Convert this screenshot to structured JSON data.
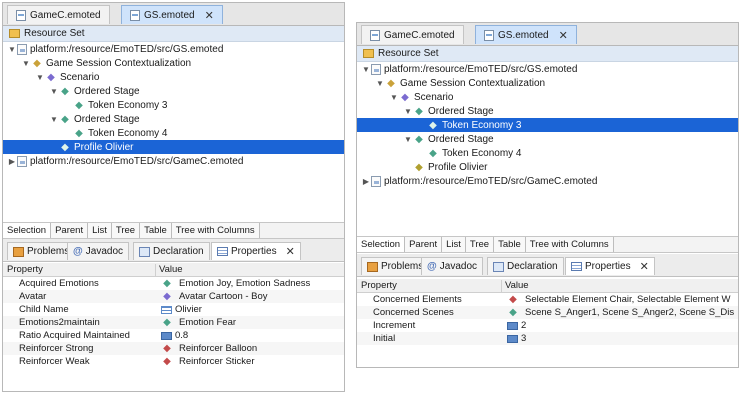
{
  "left": {
    "editor_tabs": [
      {
        "label": "GameC.emoted",
        "active": false
      },
      {
        "label": "GS.emoted",
        "active": true,
        "close": "✕"
      }
    ],
    "resource_set": "Resource Set",
    "tree": [
      {
        "label": "platform:/resource/EmoTED/src/GS.emoted",
        "icon": "page-icon",
        "twisty": "▼",
        "depth": 0
      },
      {
        "label": "Game Session Contextualization",
        "icon": "gold-diamond-icon",
        "twisty": "▼",
        "depth": 1
      },
      {
        "label": "Scenario",
        "icon": "purple-diamond-icon",
        "twisty": "▼",
        "depth": 2
      },
      {
        "label": "Ordered Stage",
        "icon": "teal-diamond-icon",
        "twisty": "▼",
        "depth": 3
      },
      {
        "label": "Token Economy 3",
        "icon": "teal-diamond-icon",
        "twisty": "",
        "depth": 4
      },
      {
        "label": "Ordered Stage",
        "icon": "teal-diamond-icon",
        "twisty": "▼",
        "depth": 3
      },
      {
        "label": "Token Economy 4",
        "icon": "teal-diamond-icon",
        "twisty": "",
        "depth": 4
      },
      {
        "label": "Profile Olivier",
        "icon": "olive-diamond-icon",
        "twisty": "",
        "depth": 3,
        "selected": true
      },
      {
        "label": "platform:/resource/EmoTED/src/GameC.emoted",
        "icon": "page-icon",
        "twisty": "▶",
        "depth": 0
      }
    ],
    "viewer_tabs": [
      "Selection",
      "Parent",
      "List",
      "Tree",
      "Table",
      "Tree with Columns"
    ],
    "view_tabs": [
      {
        "label": "Problems",
        "icon": "problems-icon"
      },
      {
        "label": "Javadoc",
        "icon": "at-icon"
      },
      {
        "label": "Declaration",
        "icon": "declaration-icon"
      },
      {
        "label": "Properties",
        "icon": "properties-icon",
        "active": true,
        "close": "✕"
      }
    ],
    "props_header": {
      "property": "Property",
      "value": "Value"
    },
    "props": [
      {
        "key": "Acquired Emotions",
        "value": "Emotion Joy, Emotion Sadness",
        "icon": "teal-diamond-icon"
      },
      {
        "key": "Avatar",
        "value": "Avatar Cartoon - Boy",
        "icon": "purple-diamond-icon"
      },
      {
        "key": "Child Name",
        "value": "Olivier",
        "icon": "list-icon"
      },
      {
        "key": "Emotions2maintain",
        "value": "Emotion Fear",
        "icon": "teal-diamond-icon"
      },
      {
        "key": "Ratio Acquired Maintained",
        "value": "0.8",
        "icon": "number-icon"
      },
      {
        "key": "Reinforcer Strong",
        "value": "Reinforcer Balloon",
        "icon": "red-diamond-icon"
      },
      {
        "key": "Reinforcer Weak",
        "value": "Reinforcer Sticker",
        "icon": "red-diamond-icon"
      }
    ]
  },
  "right": {
    "editor_tabs": [
      {
        "label": "GameC.emoted",
        "active": false
      },
      {
        "label": "GS.emoted",
        "active": true,
        "close": "✕"
      }
    ],
    "resource_set": "Resource Set",
    "tree": [
      {
        "label": "platform:/resource/EmoTED/src/GS.emoted",
        "icon": "page-icon",
        "twisty": "▼",
        "depth": 0
      },
      {
        "label": "Game Session Contextualization",
        "icon": "gold-diamond-icon",
        "twisty": "▼",
        "depth": 1
      },
      {
        "label": "Scenario",
        "icon": "purple-diamond-icon",
        "twisty": "▼",
        "depth": 2
      },
      {
        "label": "Ordered Stage",
        "icon": "teal-diamond-icon",
        "twisty": "▼",
        "depth": 3
      },
      {
        "label": "Token Economy 3",
        "icon": "teal-diamond-icon",
        "twisty": "",
        "depth": 4,
        "selected": true
      },
      {
        "label": "Ordered Stage",
        "icon": "teal-diamond-icon",
        "twisty": "▼",
        "depth": 3
      },
      {
        "label": "Token Economy 4",
        "icon": "teal-diamond-icon",
        "twisty": "",
        "depth": 4
      },
      {
        "label": "Profile Olivier",
        "icon": "olive-diamond-icon",
        "twisty": "",
        "depth": 3
      },
      {
        "label": "platform:/resource/EmoTED/src/GameC.emoted",
        "icon": "page-icon",
        "twisty": "▶",
        "depth": 0
      }
    ],
    "viewer_tabs": [
      "Selection",
      "Parent",
      "List",
      "Tree",
      "Table",
      "Tree with Columns"
    ],
    "view_tabs": [
      {
        "label": "Problems",
        "icon": "problems-icon"
      },
      {
        "label": "Javadoc",
        "icon": "at-icon"
      },
      {
        "label": "Declaration",
        "icon": "declaration-icon"
      },
      {
        "label": "Properties",
        "icon": "properties-icon",
        "active": true,
        "close": "✕"
      }
    ],
    "props_header": {
      "property": "Property",
      "value": "Value"
    },
    "props": [
      {
        "key": "Concerned Elements",
        "value": "Selectable Element Chair, Selectable Element W",
        "icon": "red-diamond-icon"
      },
      {
        "key": "Concerned Scenes",
        "value": "Scene S_Anger1, Scene S_Anger2, Scene S_Dis",
        "icon": "teal-diamond-icon"
      },
      {
        "key": "Increment",
        "value": "2",
        "icon": "number-icon"
      },
      {
        "key": "Initial",
        "value": "3",
        "icon": "number-icon"
      }
    ]
  }
}
